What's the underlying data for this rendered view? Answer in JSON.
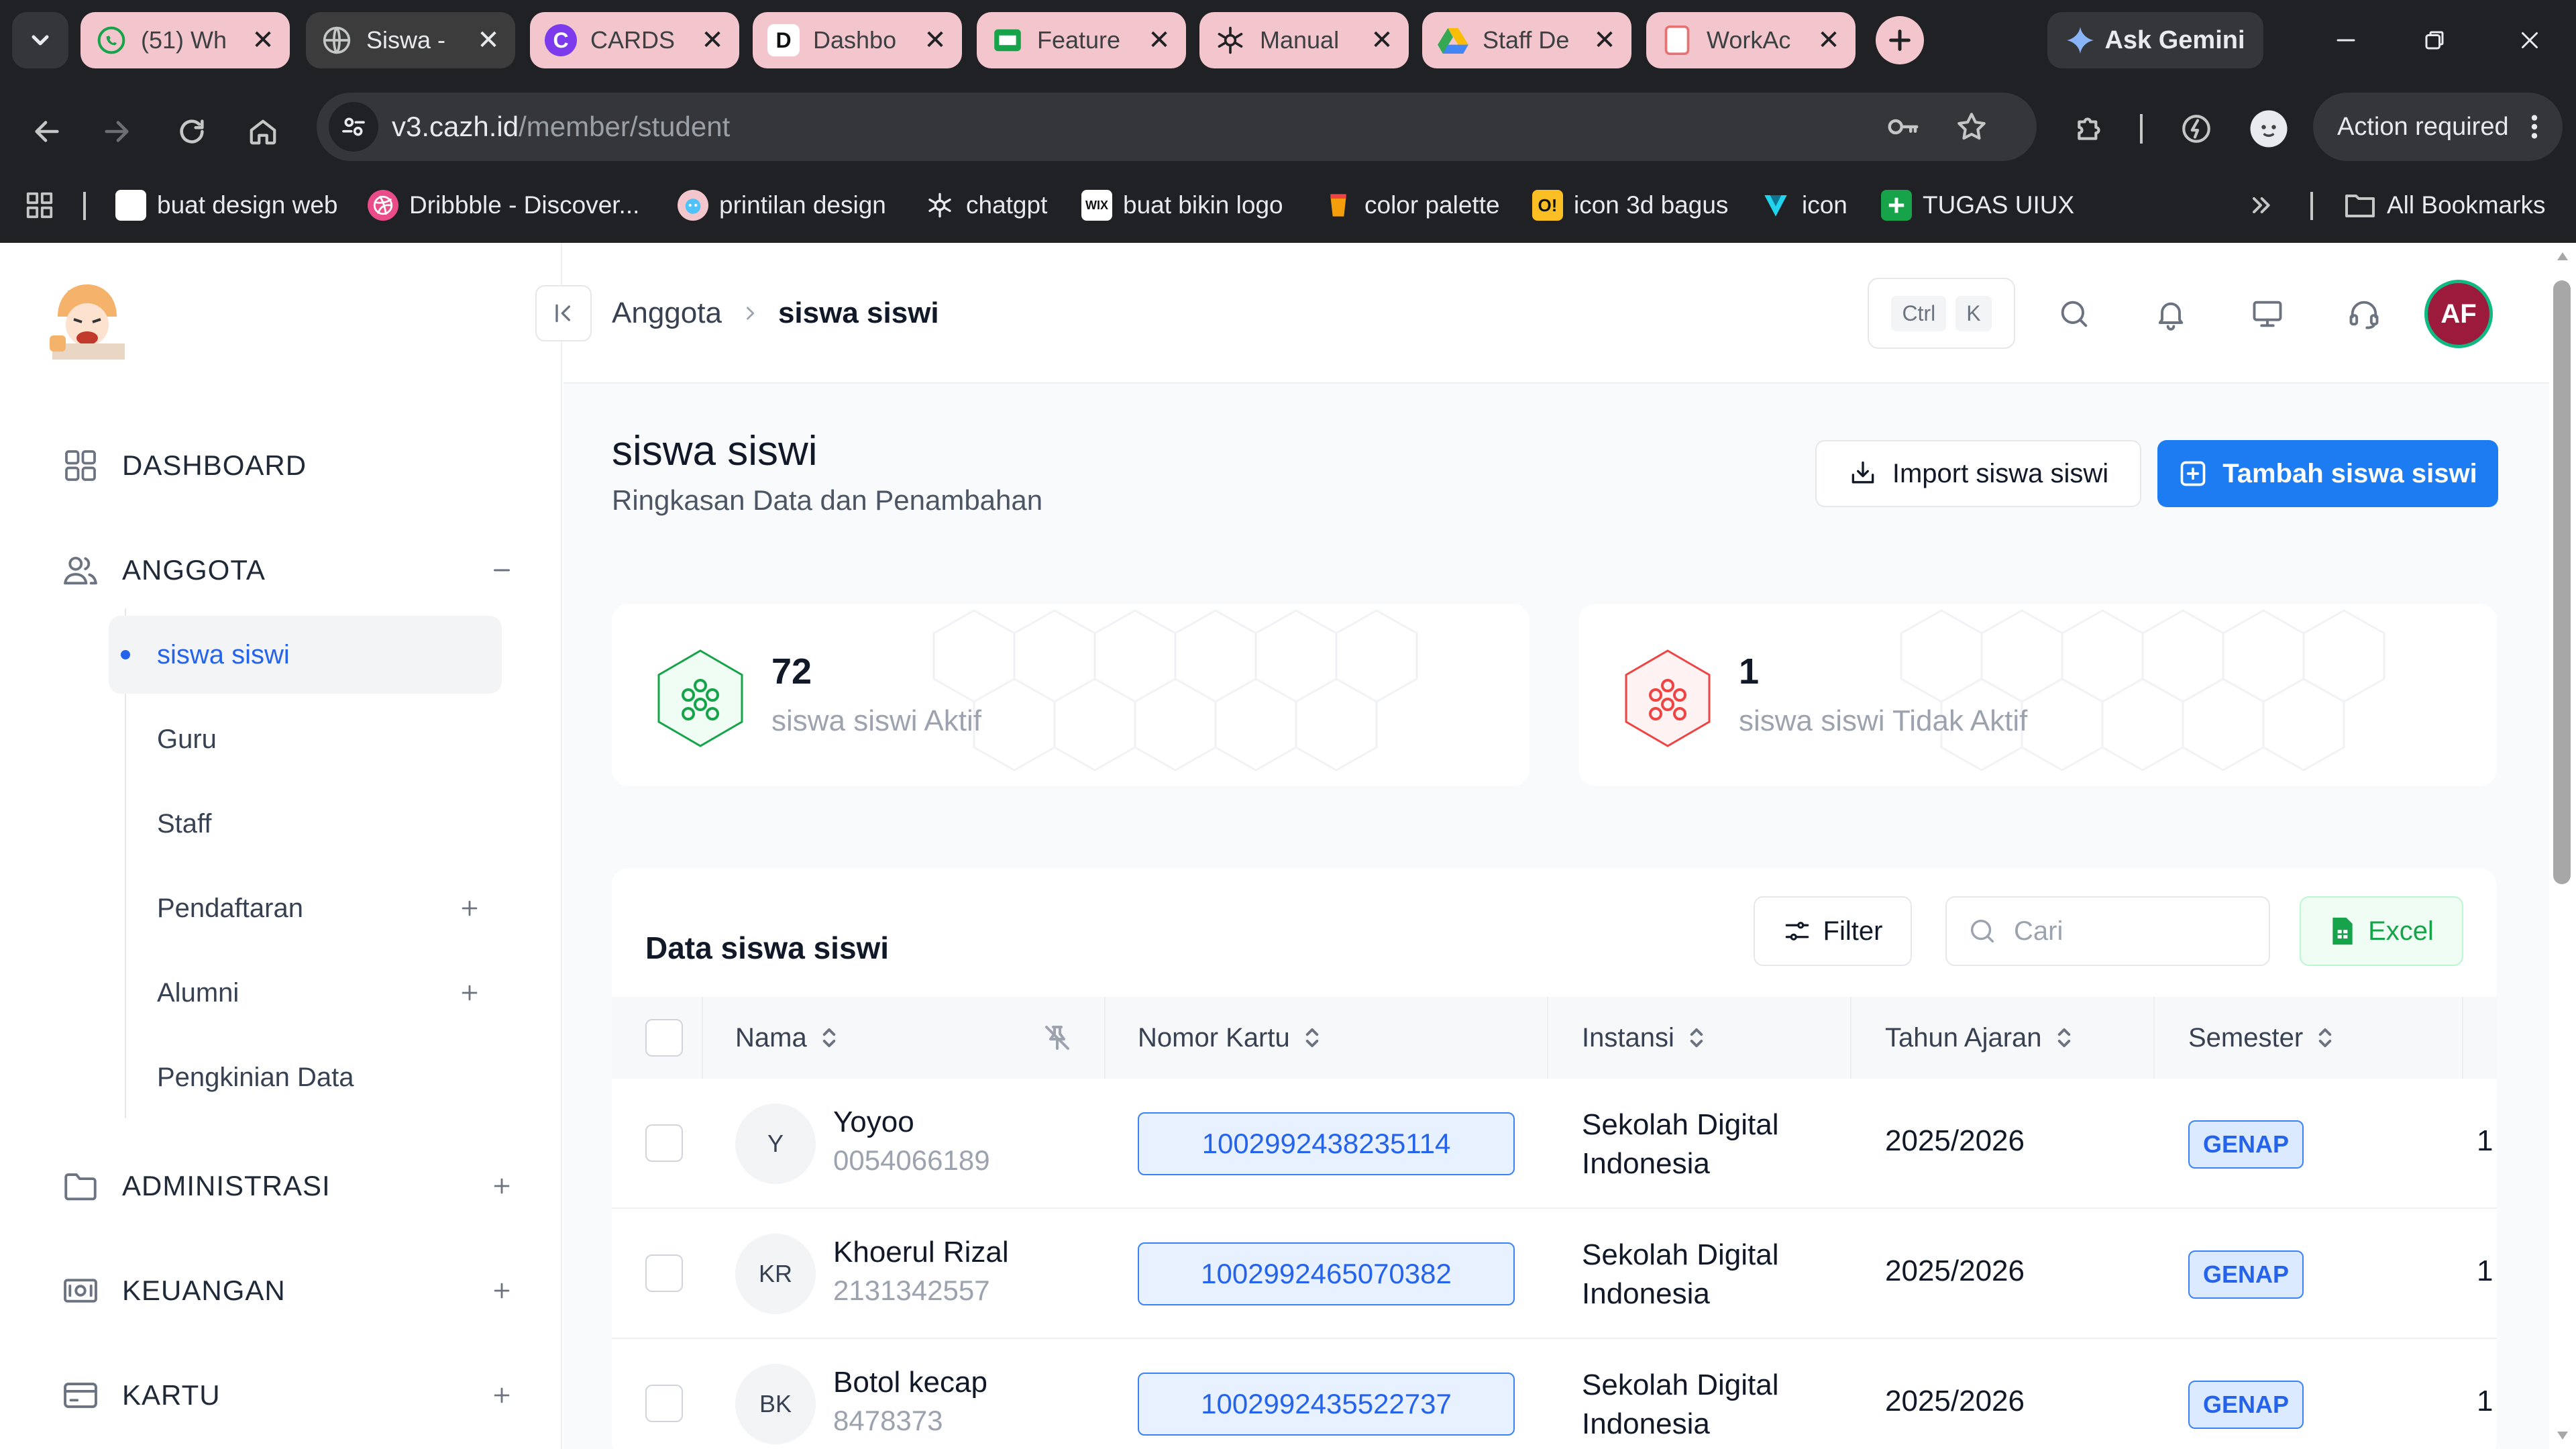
{
  "browser": {
    "tabs": [
      {
        "title": "(51) Wh",
        "favicon": "whatsapp-icon",
        "bg": "#f3c6cd",
        "active": false
      },
      {
        "title": "Siswa -",
        "favicon": "globe-icon",
        "bg": "#3c3c3c",
        "active": true
      },
      {
        "title": "CARDS",
        "favicon": "canva-icon",
        "bg": "#f3c6cd",
        "active": false
      },
      {
        "title": "Dashbo",
        "favicon": "d-icon",
        "bg": "#f3c6cd",
        "active": false
      },
      {
        "title": "Feature",
        "favicon": "slides-icon",
        "bg": "#f3c6cd",
        "active": false
      },
      {
        "title": "Manual",
        "favicon": "openai-icon",
        "bg": "#f3c6cd",
        "active": false
      },
      {
        "title": "Staff De",
        "favicon": "drive-icon",
        "bg": "#f3c6cd",
        "active": false
      },
      {
        "title": "WorkAc",
        "favicon": "page-icon",
        "bg": "#f3c6cd",
        "active": false
      }
    ],
    "gemini_label": "Ask Gemini",
    "url_host": "v3.cazh.id",
    "url_path": "/member/student",
    "action_label": "Action required",
    "bookmarks": [
      {
        "label": "buat design web",
        "icon": "page-icon"
      },
      {
        "label": "Dribbble - Discover...",
        "icon": "dribbble-icon"
      },
      {
        "label": "printilan design",
        "icon": "emoji-icon"
      },
      {
        "label": "chatgpt",
        "icon": "openai-icon"
      },
      {
        "label": "buat bikin logo",
        "icon": "wix-icon"
      },
      {
        "label": "color palette",
        "icon": "cup-icon"
      },
      {
        "label": "icon 3d bagus",
        "icon": "o-icon"
      },
      {
        "label": "icon",
        "icon": "v-icon"
      },
      {
        "label": "TUGAS UIUX",
        "icon": "sheets-icon"
      }
    ],
    "all_bookmarks_label": "All Bookmarks",
    "wix_text": "WIX",
    "o_text": "O!"
  },
  "sidebar": {
    "sections": [
      {
        "label": "DASHBOARD",
        "icon": "grid-icon"
      },
      {
        "label": "ANGGOTA",
        "icon": "users-icon"
      },
      {
        "label": "ADMINISTRASI",
        "icon": "folder-icon"
      },
      {
        "label": "KEUANGAN",
        "icon": "money-icon"
      },
      {
        "label": "KARTU",
        "icon": "card-icon"
      }
    ],
    "anggota_items": [
      {
        "label": "siswa siswi",
        "active": true
      },
      {
        "label": "Guru"
      },
      {
        "label": "Staff"
      },
      {
        "label": "Pendaftaran",
        "expandable": true
      },
      {
        "label": "Alumni",
        "expandable": true
      },
      {
        "label": "Pengkinian Data"
      }
    ]
  },
  "header": {
    "breadcrumb": [
      "Anggota",
      "siswa siswi"
    ],
    "shortcut_keys": [
      "Ctrl",
      "K"
    ],
    "avatar_initials": "AF"
  },
  "page": {
    "title": "siswa siswi",
    "subtitle": "Ringkasan Data dan Penambahan",
    "import_label": "Import siswa siswi",
    "add_label": "Tambah siswa siswi"
  },
  "stats": [
    {
      "value": "72",
      "label": "siswa siswi Aktif",
      "color": "#16a34a"
    },
    {
      "value": "1",
      "label": "siswa siswi Tidak Aktif",
      "color": "#ef4444"
    }
  ],
  "table": {
    "title": "Data siswa siswi",
    "filter_label": "Filter",
    "search_placeholder": "Cari",
    "excel_label": "Excel",
    "columns": [
      "Nama",
      "Nomor Kartu",
      "Instansi",
      "Tahun Ajaran",
      "Semester"
    ],
    "rows": [
      {
        "initials": "Y",
        "name": "Yoyoo",
        "nis": "0054066189",
        "card": "1002992438235114",
        "inst_line1": "Sekolah Digital",
        "inst_line2": "Indonesia",
        "year": "2025/2026",
        "semester": "GENAP",
        "more": "1"
      },
      {
        "initials": "KR",
        "name": "Khoerul Rizal",
        "nis": "2131342557",
        "card": "1002992465070382",
        "inst_line1": "Sekolah Digital",
        "inst_line2": "Indonesia",
        "year": "2025/2026",
        "semester": "GENAP",
        "more": "1"
      },
      {
        "initials": "BK",
        "name": "Botol kecap",
        "nis": "8478373",
        "card": "1002992435522737",
        "inst_line1": "Sekolah Digital",
        "inst_line2": "Indonesia",
        "year": "2025/2026",
        "semester": "GENAP",
        "more": "1"
      }
    ]
  }
}
